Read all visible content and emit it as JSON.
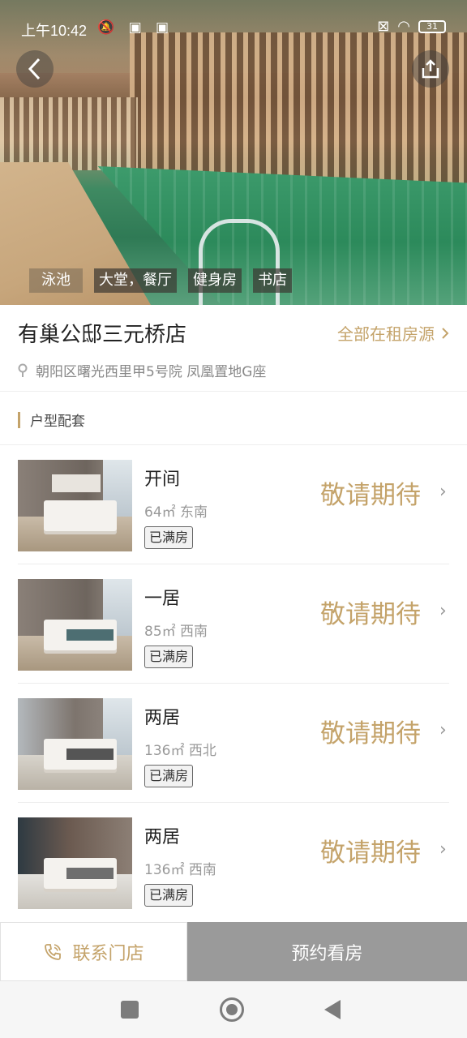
{
  "status": {
    "time": "上午10:42",
    "battery": "31"
  },
  "hero": {
    "tags": [
      "泳池",
      "大堂，餐厅",
      "健身房",
      "书店"
    ]
  },
  "store": {
    "title": "有巢公邸三元桥店",
    "all_listings": "全部在租房源",
    "address": "朝阳区曙光西里甲5号院 凤凰置地G座"
  },
  "section": {
    "title": "户型配套"
  },
  "rooms": [
    {
      "name": "开间",
      "meta": "64㎡ 东南",
      "status": "已满房",
      "price": "敬请期待"
    },
    {
      "name": "一居",
      "meta": "85㎡ 西南",
      "status": "已满房",
      "price": "敬请期待"
    },
    {
      "name": "两居",
      "meta": "136㎡ 西北",
      "status": "已满房",
      "price": "敬请期待"
    },
    {
      "name": "两居",
      "meta": "136㎡ 西南",
      "status": "已满房",
      "price": "敬请期待"
    }
  ],
  "actions": {
    "contact": "联系门店",
    "book": "预约看房"
  },
  "colors": {
    "accent": "#c4a36a",
    "book_button": "#9a9a9a"
  },
  "icons": [
    "back-icon",
    "share-icon",
    "location-icon",
    "chevron-right-icon",
    "phone-icon"
  ]
}
